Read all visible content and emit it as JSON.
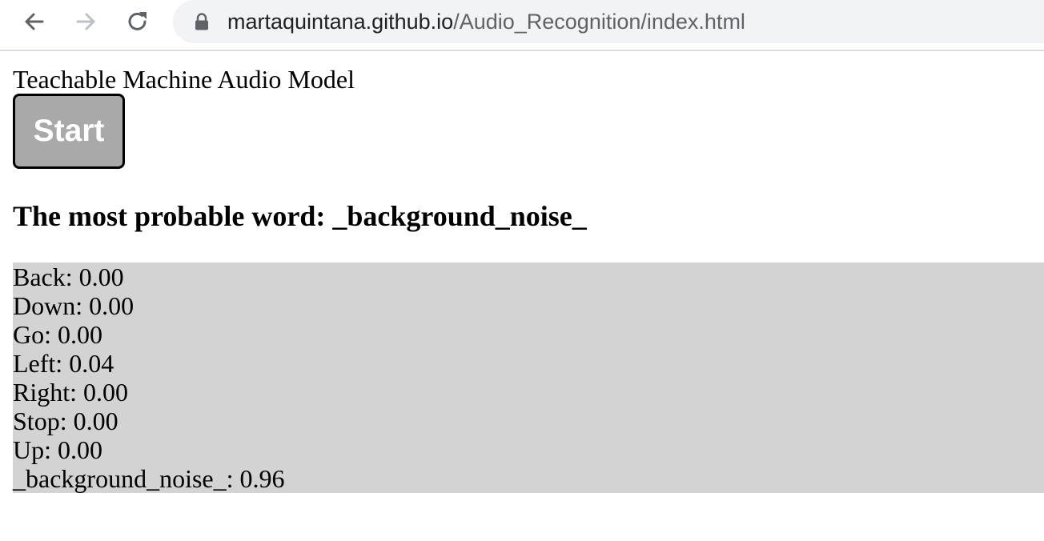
{
  "browser": {
    "url_host": "martaquintana.github.io",
    "url_path": "/Audio_Recognition/index.html",
    "icons": {
      "back": "arrow-left-icon",
      "forward": "arrow-right-icon",
      "reload": "reload-icon",
      "secure": "lock-icon"
    }
  },
  "page": {
    "title": "Teachable Machine Audio Model",
    "start_button_label": "Start",
    "result_heading": "The most probable word: _background_noise_"
  },
  "predictions": [
    {
      "text": "Back: 0.00"
    },
    {
      "text": "Down: 0.00"
    },
    {
      "text": "Go: 0.00"
    },
    {
      "text": "Left: 0.04"
    },
    {
      "text": "Right: 0.00"
    },
    {
      "text": "Stop: 0.00"
    },
    {
      "text": "Up: 0.00"
    },
    {
      "text": "_background_noise_: 0.96"
    }
  ],
  "colors": {
    "button_background": "#a9a9a9",
    "label_container_background": "#d3d3d3",
    "omnibox_background": "#f1f3f4"
  }
}
